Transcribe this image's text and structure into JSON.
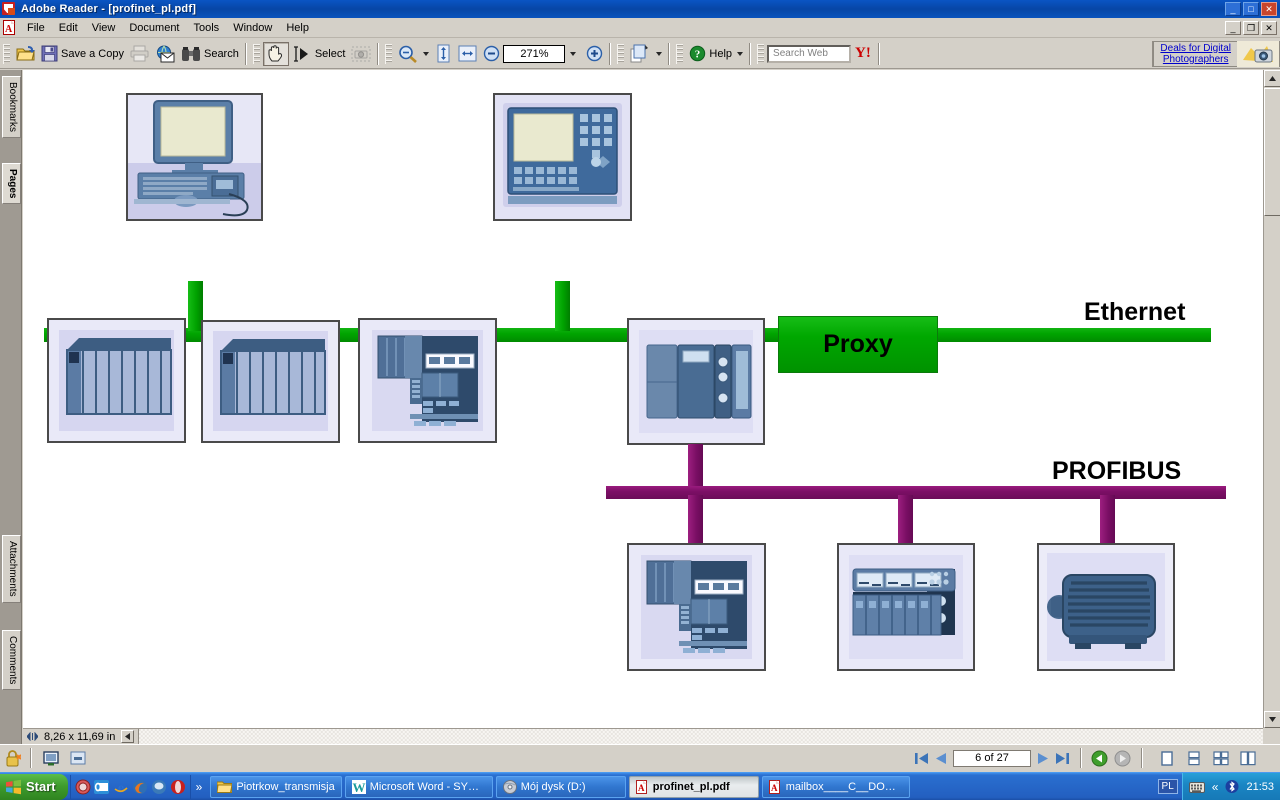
{
  "window": {
    "title": "Adobe Reader - [profinet_pl.pdf]",
    "app_icon": "acrobat-icon",
    "minimize": "_",
    "maximize": "□",
    "close": "✕",
    "inner_minimize": "_",
    "inner_restore": "❐",
    "inner_close": "✕"
  },
  "menu": {
    "items": [
      "File",
      "Edit",
      "View",
      "Document",
      "Tools",
      "Window",
      "Help"
    ]
  },
  "toolbar": {
    "open_label": "",
    "save_label": "Save a Copy",
    "print_label": "",
    "email_label": "",
    "search_label": "Search",
    "hand_label": "",
    "select_label": "Select",
    "snapshot_label": "",
    "zoom_out_label": "",
    "fit_page_label": "",
    "fit_width_label": "",
    "zoom_minus_label": "",
    "zoom_value": "271%",
    "zoom_plus_label": "",
    "pages_label": "",
    "help_label": "Help",
    "search_web_placeholder": "Search Web",
    "yahoo_label": "Y!",
    "ad_line1": "Deals for Digital",
    "ad_line2": "Photographers"
  },
  "sidebar": {
    "tabs": [
      {
        "label": "Bookmarks",
        "selected": false
      },
      {
        "label": "Pages",
        "selected": true
      },
      {
        "label": "Attachments",
        "selected": false
      },
      {
        "label": "Comments",
        "selected": false
      }
    ]
  },
  "document": {
    "page_size": "8,26 x 11,69 in",
    "page_indicator": "6 of 27",
    "first_page": "⏮",
    "prev_page": "◀",
    "next_page": "▶",
    "last_page": "⏭",
    "prev_view": "←",
    "next_view": "→"
  },
  "diagram": {
    "ethernet_label": "Ethernet",
    "profibus_label": "PROFIBUS",
    "proxy_label": "Proxy",
    "ethernet_color": "#00a500",
    "profibus_color": "#7d0f67",
    "devices": [
      {
        "id": "pc-workstation",
        "icon": "desktop-pc-icon",
        "bus": "ethernet",
        "row": "top"
      },
      {
        "id": "hmi-operator-panel",
        "icon": "hmi-panel-icon",
        "bus": "ethernet",
        "row": "top"
      },
      {
        "id": "plc-rack-1",
        "icon": "plc-rack-icon",
        "bus": "ethernet",
        "row": "bottom"
      },
      {
        "id": "plc-rack-2",
        "icon": "plc-rack-icon",
        "bus": "ethernet",
        "row": "bottom"
      },
      {
        "id": "controller-station",
        "icon": "controller-rack-icon",
        "bus": "ethernet",
        "row": "bottom"
      },
      {
        "id": "proxy-gateway-plc",
        "icon": "gateway-plc-icon",
        "bus": "both",
        "row": "bottom"
      },
      {
        "id": "profibus-controller",
        "icon": "controller-rack-icon",
        "bus": "profibus",
        "row": "bottom"
      },
      {
        "id": "distributed-io",
        "icon": "io-terminal-icon",
        "bus": "profibus",
        "row": "bottom"
      },
      {
        "id": "electric-motor",
        "icon": "motor-icon",
        "bus": "profibus",
        "row": "bottom"
      }
    ]
  },
  "statusbar": {
    "security_icon": "lock-icon",
    "single_page_view": "single-page-icon",
    "continuous_view": "continuous-page-icon"
  },
  "taskbar": {
    "start_label": "Start",
    "quick_launch": [
      "media-player-icon",
      "outlook-icon",
      "internet-explorer-icon",
      "firefox-icon",
      "messenger-icon",
      "opera-icon"
    ],
    "overflow": "»",
    "tasks": [
      {
        "label": "Piotrkow_transmisja",
        "icon": "folder-icon",
        "active": false
      },
      {
        "label": "Microsoft Word - SYSTE...",
        "icon": "word-icon",
        "active": false
      },
      {
        "label": "Mój dysk (D:)",
        "icon": "drive-icon",
        "active": false
      },
      {
        "label": "profinet_pl.pdf",
        "icon": "acrobat-icon",
        "active": true
      },
      {
        "label": "mailbox____C__DOCUM...",
        "icon": "acrobat-icon",
        "active": false
      }
    ],
    "language": "PL",
    "tray_icons": [
      "keyboard-icon",
      "show-hidden-icon",
      "bluetooth-icon"
    ],
    "clock": "21:53"
  }
}
